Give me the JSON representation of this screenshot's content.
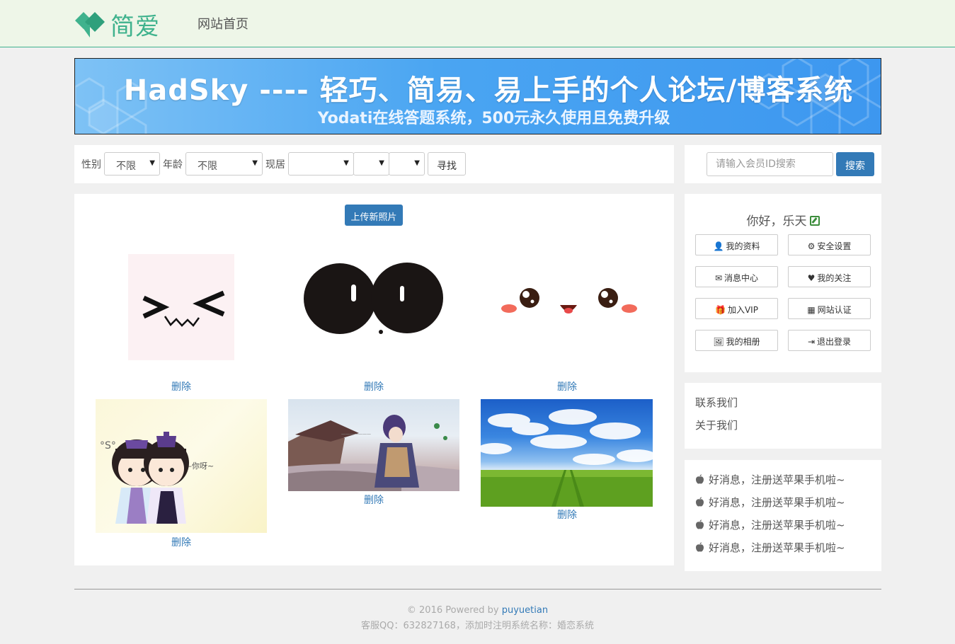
{
  "header": {
    "logo_text": "简爱",
    "nav_home": "网站首页",
    "brand_color": "#3fb28d"
  },
  "banner": {
    "title": "HadSky ---- 轻巧、简易、易上手的个人论坛/博客系统",
    "subtitle": "Yodati在线答题系统，500元永久使用且免费升级"
  },
  "filter": {
    "gender_label": "性别",
    "gender_value": "不限",
    "age_label": "年龄",
    "age_value": "不限",
    "residence_label": "现居",
    "residence_values": [
      "",
      "",
      ""
    ],
    "find_label": "寻找"
  },
  "search": {
    "placeholder": "请输入会员ID搜索",
    "button_label": "搜索"
  },
  "gallery": {
    "upload_label": "上传新照片",
    "photos": [
      {
        "image": "emoticon-squint-face",
        "delete_label": "删除"
      },
      {
        "image": "black-blob-eyes",
        "delete_label": "删除"
      },
      {
        "image": "cute-blush-face",
        "delete_label": "删除"
      },
      {
        "image": "chibi-couple",
        "delete_label": "删除"
      },
      {
        "image": "game-character-scene",
        "delete_label": "删除"
      },
      {
        "image": "sky-and-field",
        "delete_label": "删除"
      }
    ]
  },
  "user": {
    "greeting": "你好，乐天",
    "buttons": [
      {
        "icon": "user-icon",
        "glyph": "👤",
        "label": "我的资料"
      },
      {
        "icon": "gear-icon",
        "glyph": "⚙",
        "label": "安全设置"
      },
      {
        "icon": "envelope-icon",
        "glyph": "✉",
        "label": "消息中心"
      },
      {
        "icon": "heart-icon",
        "glyph": "♥",
        "label": "我的关注"
      },
      {
        "icon": "gift-icon",
        "glyph": "🎁",
        "label": "加入VIP"
      },
      {
        "icon": "qrcode-icon",
        "glyph": "▦",
        "label": "网站认证"
      },
      {
        "icon": "picture-icon",
        "glyph": "🖼",
        "label": "我的相册"
      },
      {
        "icon": "logout-icon",
        "glyph": "⇥",
        "label": "退出登录"
      }
    ]
  },
  "links": {
    "contact": "联系我们",
    "about": "关于我们"
  },
  "news": {
    "items": [
      "好消息，注册送苹果手机啦~",
      "好消息，注册送苹果手机啦~",
      "好消息，注册送苹果手机啦~",
      "好消息，注册送苹果手机啦~"
    ]
  },
  "footer": {
    "copyright": "© 2016 Powered by ",
    "powered_link": "puyuetian",
    "contact": "客服QQ：632827168，添加时注明系统名称：婚恋系统"
  }
}
